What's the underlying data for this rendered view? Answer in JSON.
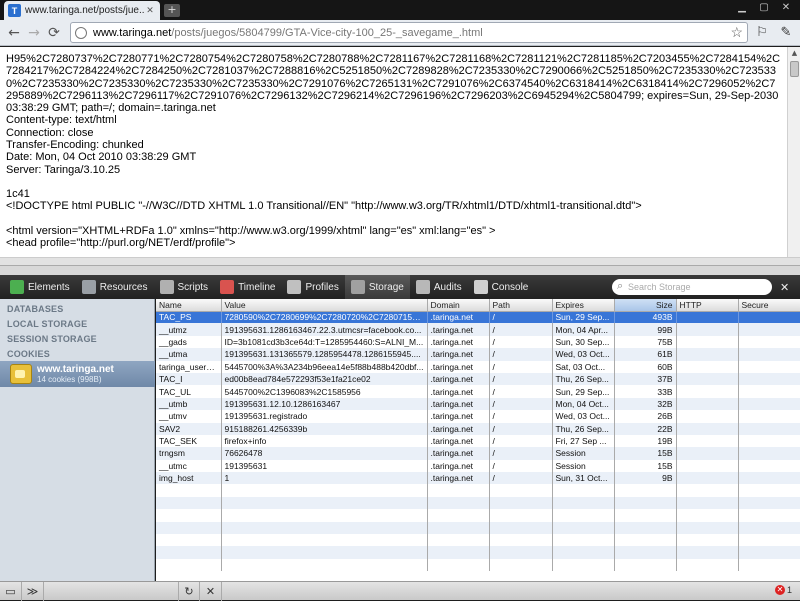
{
  "browser": {
    "tab_title": "www.taringa.net/posts/jue...",
    "tab_favicon": "T",
    "url_host": "www.taringa.net",
    "url_path": "/posts/juegos/5804799/GTA-Vice-city-100_25-_savegame_.html"
  },
  "page": {
    "lines": [
      "H95%2C7280737%2C7280771%2C7280754%2C7280758%2C7280788%2C7281167%2C7281168%2C7281121%2C7281185%2C7203455%2C7284154%2C7284217%2C7284224%2C7284250%2C7281037%2C7288816%2C5251850%2C7289828%2C7235330%2C7290066%2C5251850%2C7235330%2C7235330%2C7235330%2C7235330%2C7235330%2C7235330%2C7291076%2C7265131%2C7291076%2C6374540%2C6318414%2C6318414%2C7296052%2C7295889%2C7296113%2C7296117%2C7291076%2C7296132%2C7296214%2C7296196%2C7296203%2C6945294%2C5804799; expires=Sun, 29-Sep-2030 03:38:29 GMT; path=/; domain=.taringa.net",
      "Content-type: text/html",
      "Connection: close",
      "Transfer-Encoding: chunked",
      "Date: Mon, 04 Oct 2010 03:38:29 GMT",
      "Server: Taringa/3.10.25",
      "",
      "1c41",
      "<!DOCTYPE html PUBLIC \"-//W3C//DTD XHTML 1.0 Transitional//EN\" \"http://www.w3.org/TR/xhtml1/DTD/xhtml1-transitional.dtd\">",
      "",
      "<html version=\"XHTML+RDFa 1.0\"  xmlns=\"http://www.w3.org/1999/xhtml\" lang=\"es\" xml:lang=\"es\" >",
      "<head profile=\"http://purl.org/NET/erdf/profile\">"
    ]
  },
  "devtools": {
    "tabs": [
      {
        "label": "Elements",
        "icon": "elements-icon",
        "color": "#4caf50"
      },
      {
        "label": "Resources",
        "icon": "resources-icon",
        "color": "#9aa0a6"
      },
      {
        "label": "Scripts",
        "icon": "scripts-icon",
        "color": "#b0b0b0"
      },
      {
        "label": "Timeline",
        "icon": "timeline-icon",
        "color": "#d9534f"
      },
      {
        "label": "Profiles",
        "icon": "profiles-icon",
        "color": "#c0c0c0"
      },
      {
        "label": "Storage",
        "icon": "storage-icon",
        "color": "#a0a0a0"
      },
      {
        "label": "Audits",
        "icon": "audits-icon",
        "color": "#b8b8b8"
      },
      {
        "label": "Console",
        "icon": "console-icon",
        "color": "#d0d0d0"
      }
    ],
    "active_tab": "Storage",
    "search_placeholder": "Search Storage",
    "sidebar": {
      "sections": [
        "DATABASES",
        "LOCAL STORAGE",
        "SESSION STORAGE",
        "COOKIES"
      ],
      "selected_host": "www.taringa.net",
      "selected_sub": "14 cookies (998B)"
    },
    "grid": {
      "columns": [
        "Name",
        "Value",
        "Domain",
        "Path",
        "Expires",
        "Size",
        "HTTP",
        "Secure"
      ],
      "rows": [
        [
          "TAC_PS",
          "7280590%2C7280699%2C7280720%2C7280715%...",
          ".taringa.net",
          "/",
          "Sun, 29 Sep...",
          "493B",
          "",
          ""
        ],
        [
          "__utmz",
          "191395631.1286163467.22.3.utmcsr=facebook.co...",
          ".taringa.net",
          "/",
          "Mon, 04 Apr...",
          "99B",
          "",
          ""
        ],
        [
          "__gads",
          "ID=3b1081cd3b3ce64d:T=1285954460:S=ALNI_M...",
          ".taringa.net",
          "/",
          "Sun, 30 Sep...",
          "75B",
          "",
          ""
        ],
        [
          "__utma",
          "191395631.131365579.1285954478.1286155945....",
          ".taringa.net",
          "/",
          "Wed, 03 Oct...",
          "61B",
          "",
          ""
        ],
        [
          "taringa_user_id",
          "5445700%3A%3A234b96eea14e5f88b488b420dbf...",
          ".taringa.net",
          "/",
          "Sat, 03 Oct...",
          "60B",
          "",
          ""
        ],
        [
          "TAC_I",
          "ed00b8ead784e572293f53e1fa21ce02",
          ".taringa.net",
          "/",
          "Thu, 26 Sep...",
          "37B",
          "",
          ""
        ],
        [
          "TAC_UL",
          "5445700%2C1396083%2C1585956",
          ".taringa.net",
          "/",
          "Sun, 29 Sep...",
          "33B",
          "",
          ""
        ],
        [
          "__utmb",
          "191395631.12.10.1286163467",
          ".taringa.net",
          "/",
          "Mon, 04 Oct...",
          "32B",
          "",
          ""
        ],
        [
          "__utmv",
          "191395631.registrado",
          ".taringa.net",
          "/",
          "Wed, 03 Oct...",
          "26B",
          "",
          ""
        ],
        [
          "SAV2",
          "915188261.4256339b",
          ".taringa.net",
          "/",
          "Thu, 26 Sep...",
          "22B",
          "",
          ""
        ],
        [
          "TAC_SEK",
          "firefox+info",
          ".taringa.net",
          "/",
          "Fri, 27 Sep ...",
          "19B",
          "",
          ""
        ],
        [
          "trngsm",
          "76626478",
          ".taringa.net",
          "/",
          "Session",
          "15B",
          "",
          ""
        ],
        [
          "__utmc",
          "191395631",
          ".taringa.net",
          "/",
          "Session",
          "15B",
          "",
          ""
        ],
        [
          "img_host",
          "1",
          ".taringa.net",
          "/",
          "Sun, 31 Oct...",
          "9B",
          "",
          ""
        ]
      ],
      "sorted_column": "Size"
    },
    "error_count": "1"
  }
}
